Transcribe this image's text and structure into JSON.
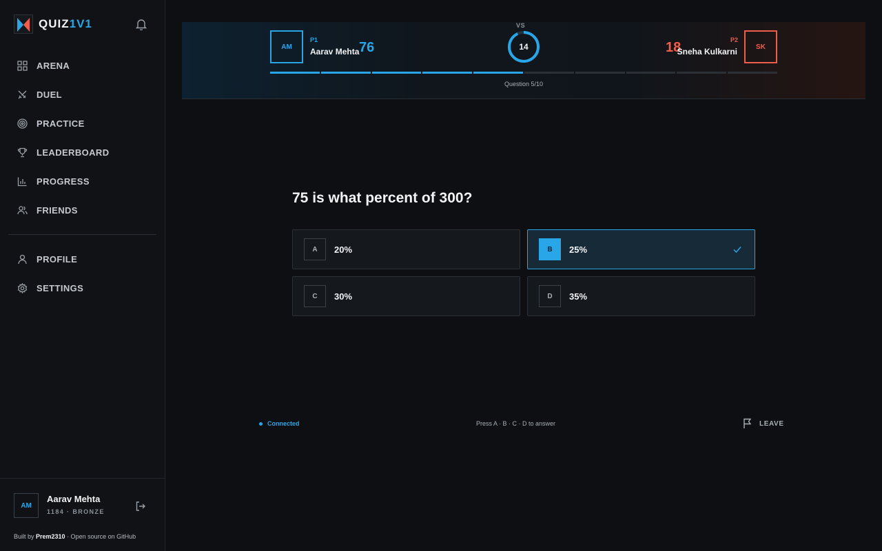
{
  "brand": {
    "name_main": "QUIZ",
    "name_accent": "1V1"
  },
  "nav": {
    "items": [
      {
        "label": "ARENA",
        "icon": "grid-icon"
      },
      {
        "label": "DUEL",
        "icon": "swords-icon"
      },
      {
        "label": "PRACTICE",
        "icon": "target-icon"
      },
      {
        "label": "LEADERBOARD",
        "icon": "trophy-icon"
      },
      {
        "label": "PROGRESS",
        "icon": "bar-chart-icon"
      },
      {
        "label": "FRIENDS",
        "icon": "users-icon"
      }
    ],
    "secondary": [
      {
        "label": "PROFILE",
        "icon": "user-icon"
      },
      {
        "label": "SETTINGS",
        "icon": "gear-icon"
      }
    ]
  },
  "user": {
    "initials": "AM",
    "name": "Aarav Mehta",
    "meta": "1184 · BRONZE"
  },
  "credit": {
    "prefix": "Built by ",
    "author": "Prem2310",
    "suffix": " · Open source on GitHub"
  },
  "match": {
    "vs_label": "VS",
    "timer": "14",
    "timer_fraction": 0.93,
    "question_label": "Question 5/10",
    "total_questions": 10,
    "completed_questions": 5,
    "p1": {
      "tag": "P1",
      "initials": "AM",
      "name": "Aarav Mehta",
      "score": "76"
    },
    "p2": {
      "tag": "P2",
      "initials": "SK",
      "name": "Sneha Kulkarni",
      "score": "18"
    }
  },
  "question": {
    "text": "75 is what percent of 300?",
    "options": [
      {
        "key": "A",
        "value": "20%"
      },
      {
        "key": "B",
        "value": "25%"
      },
      {
        "key": "C",
        "value": "30%"
      },
      {
        "key": "D",
        "value": "35%"
      }
    ],
    "selected": "B"
  },
  "footer": {
    "status": "Connected",
    "hint": "Press A · B · C · D to answer",
    "leave_label": "LEAVE"
  },
  "colors": {
    "p1": "#29a6e8",
    "p2": "#f05d4b",
    "background": "#0d0f12"
  }
}
